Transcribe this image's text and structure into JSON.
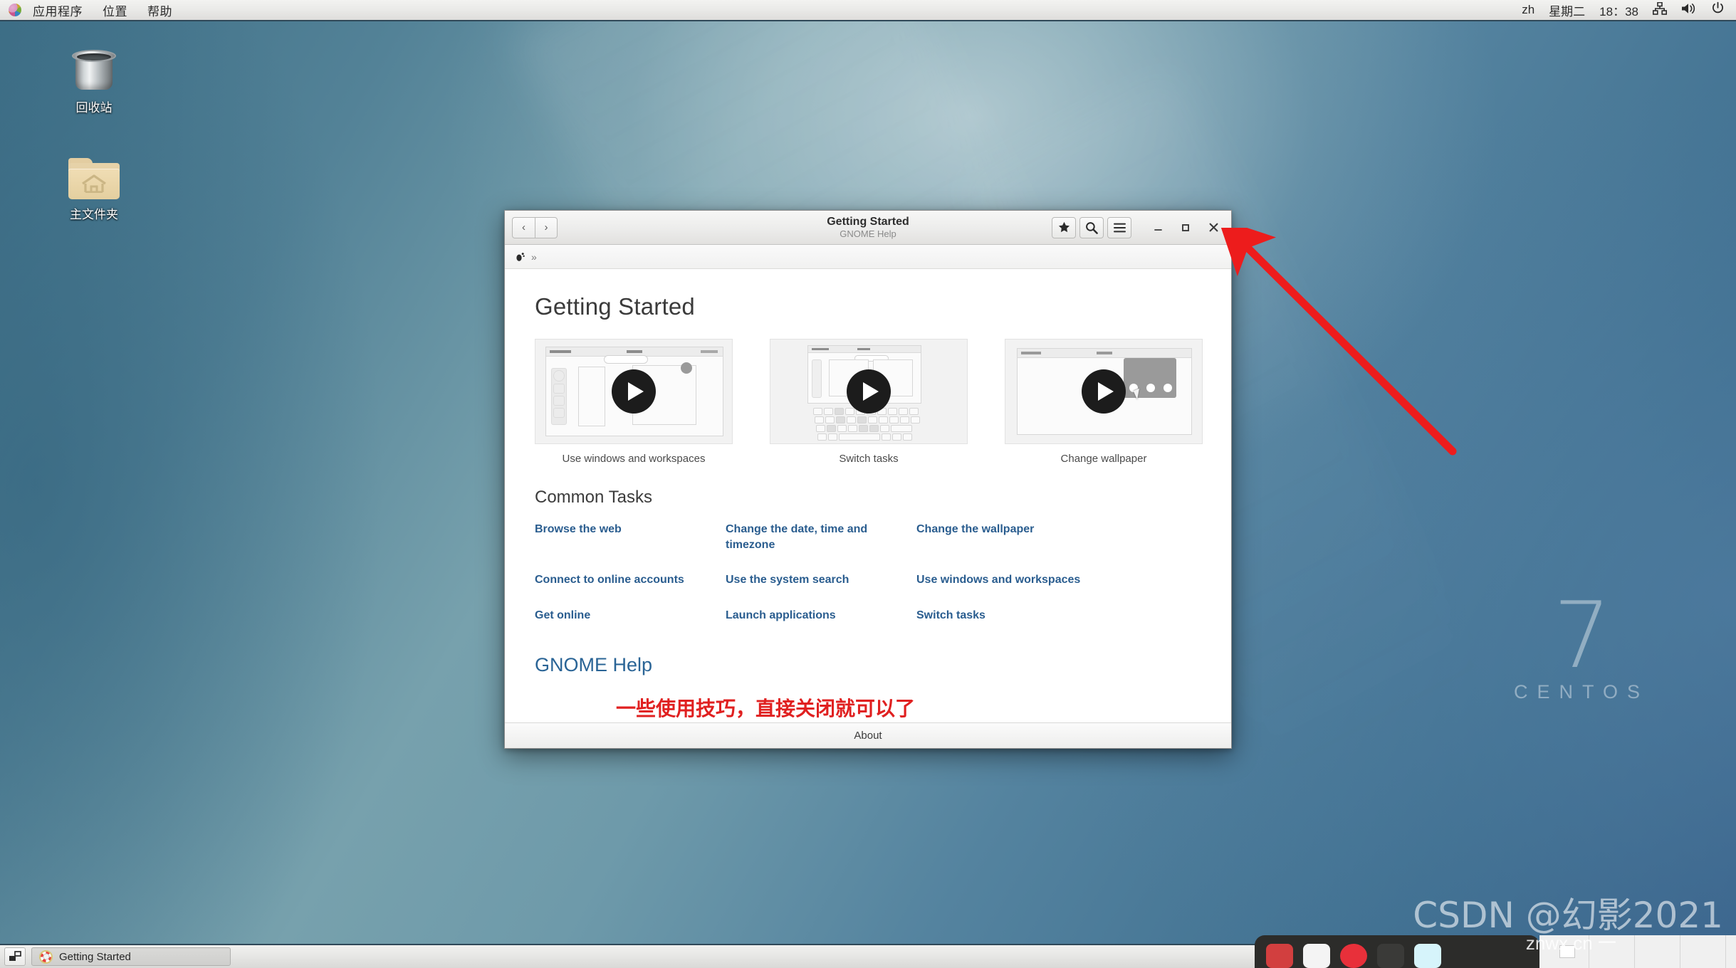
{
  "top_panel": {
    "logo_icon": "gnome-foot-icon",
    "menus": [
      "应用程序",
      "位置",
      "帮助"
    ],
    "right": {
      "input_source": "zh",
      "day": "星期二",
      "clock": "18：38",
      "network_icon": "network-wired-icon",
      "volume_icon": "volume-icon",
      "power_icon": "power-icon"
    }
  },
  "desktop_icons": [
    {
      "name": "trash-icon",
      "label": "回收站"
    },
    {
      "name": "home-folder-icon",
      "label": "主文件夹"
    }
  ],
  "window": {
    "title": "Getting Started",
    "subtitle": "GNOME Help",
    "nav": {
      "back": "‹",
      "forward": "›"
    },
    "toolbar_buttons": [
      {
        "name": "bookmark-star-button",
        "glyph": "★"
      },
      {
        "name": "search-button",
        "glyph": "search-icon"
      },
      {
        "name": "menu-button",
        "glyph": "hamburger-icon"
      }
    ],
    "window_controls": [
      {
        "name": "minimize-button",
        "glyph": "_"
      },
      {
        "name": "maximize-button",
        "glyph": "▫"
      },
      {
        "name": "close-button",
        "glyph": "✕"
      }
    ],
    "breadcrumb": {
      "home_icon": "gnome-foot-icon",
      "more": "»"
    },
    "content": {
      "heading": "Getting Started",
      "videos": [
        {
          "caption": "Use windows and workspaces",
          "play_icon": "play-icon"
        },
        {
          "caption": "Switch tasks",
          "play_icon": "play-icon"
        },
        {
          "caption": "Change wallpaper",
          "play_icon": "play-icon"
        }
      ],
      "common_tasks_heading": "Common Tasks",
      "tasks": [
        "Browse the web",
        "Change the date, time and timezone",
        "Change the wallpaper",
        "Connect to online accounts",
        "Use the system search",
        "Use windows and workspaces",
        "Get online",
        "Launch applications",
        "Switch tasks"
      ],
      "gnome_help_link": "GNOME Help",
      "annotation_note": "一些使用技巧，直接关闭就可以了"
    },
    "footer": {
      "about": "About"
    }
  },
  "bottom_panel": {
    "show_desktop_icon": "show-desktop-icon",
    "tasks": [
      {
        "icon": "help-lifering-icon",
        "label": "Getting Started"
      }
    ]
  },
  "watermarks": {
    "centos_number": "7",
    "centos_word": "CENTOS",
    "csdn": "CSDN @幻影2021",
    "znwx": "znwx.cn 一"
  },
  "annotation": {
    "arrow_color": "#ed1c1c",
    "note_color": "#e02020",
    "points_to": "close-button"
  },
  "colors": {
    "link": "#2a5d8f",
    "heading": "#3b3b3b",
    "panel_bg": "#ececea",
    "desktop_blue": "#43738f"
  }
}
